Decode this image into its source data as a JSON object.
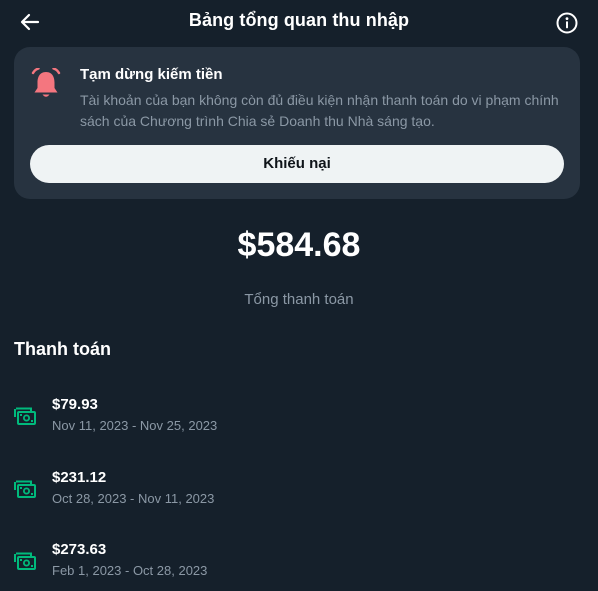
{
  "header": {
    "title": "Bảng tổng quan thu nhập"
  },
  "alert": {
    "title": "Tạm dừng kiếm tiền",
    "body": "Tài khoản của bạn không còn đủ điều kiện nhận thanh toán do vi phạm chính sách của Chương trình Chia sẻ Doanh thu Nhà sáng tạo.",
    "button_label": "Khiếu nại",
    "icon_color": "#f4767f"
  },
  "summary": {
    "total": "$584.68",
    "label": "Tổng thanh toán"
  },
  "payments": {
    "title": "Thanh toán",
    "icon_color": "#00ba7c",
    "items": [
      {
        "amount": "$79.93",
        "dates": "Nov 11, 2023 - Nov 25, 2023"
      },
      {
        "amount": "$231.12",
        "dates": "Oct 28, 2023 - Nov 11, 2023"
      },
      {
        "amount": "$273.63",
        "dates": "Feb 1, 2023 - Oct 28, 2023"
      }
    ]
  },
  "colors": {
    "background": "#15202b",
    "card": "#273340",
    "muted_text": "#8b98a5"
  }
}
